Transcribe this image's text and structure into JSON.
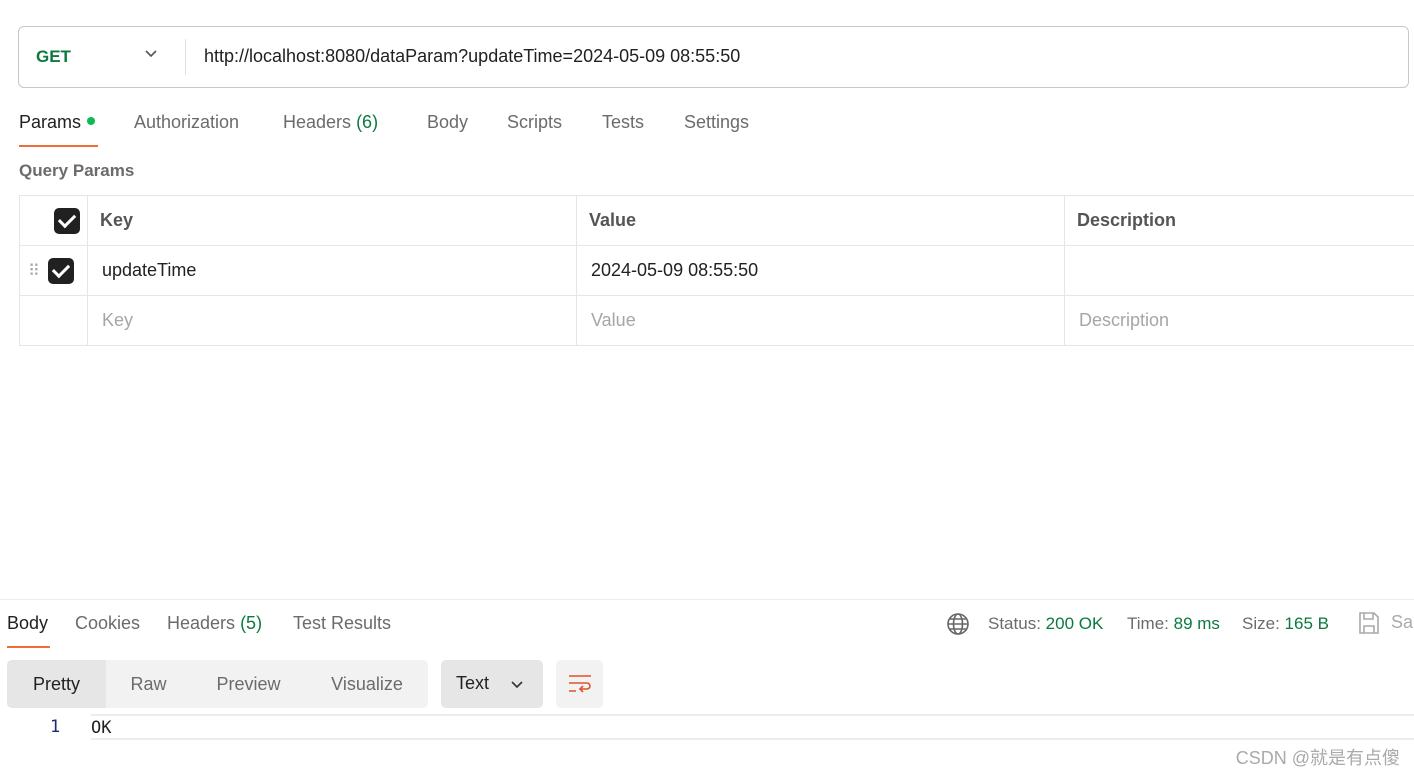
{
  "request": {
    "method": "GET",
    "url": "http://localhost:8080/dataParam?updateTime=2024-05-09 08:55:50"
  },
  "request_tabs": [
    {
      "label": "Params",
      "active": true,
      "has_dot": true
    },
    {
      "label": "Authorization"
    },
    {
      "label": "Headers",
      "count": "(6)"
    },
    {
      "label": "Body"
    },
    {
      "label": "Scripts"
    },
    {
      "label": "Tests"
    },
    {
      "label": "Settings"
    }
  ],
  "query_params": {
    "title": "Query Params",
    "columns": [
      "Key",
      "Value",
      "Description"
    ],
    "rows": [
      {
        "key": "updateTime",
        "value": "2024-05-09 08:55:50",
        "description": "",
        "checked": true
      }
    ],
    "placeholders": {
      "key": "Key",
      "value": "Value",
      "description": "Description"
    }
  },
  "response_tabs": [
    {
      "label": "Body",
      "active": true
    },
    {
      "label": "Cookies"
    },
    {
      "label": "Headers",
      "count": "(5)"
    },
    {
      "label": "Test Results"
    }
  ],
  "status": {
    "status_label": "Status:",
    "status_value": "200 OK",
    "time_label": "Time:",
    "time_value": "89 ms",
    "size_label": "Size:",
    "size_value": "165 B",
    "save_label": "Sa"
  },
  "view_modes": [
    "Pretty",
    "Raw",
    "Preview",
    "Visualize"
  ],
  "format": "Text",
  "body_lines": [
    {
      "num": "1",
      "text": "OK"
    }
  ],
  "watermark": "CSDN @就是有点傻",
  "colors": {
    "accent": "#f26b3a",
    "success": "#0b7a3e",
    "dot": "#0cbb52"
  }
}
